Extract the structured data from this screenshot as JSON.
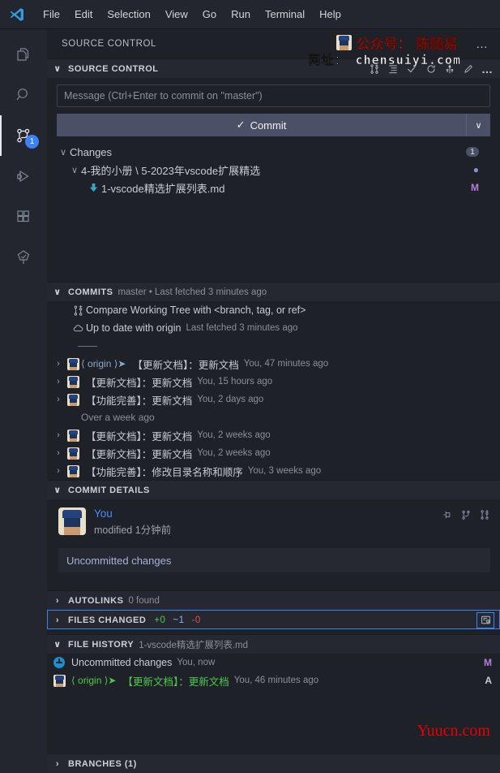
{
  "window": {
    "menu": [
      "File",
      "Edit",
      "Selection",
      "View",
      "Go",
      "Run",
      "Terminal",
      "Help"
    ],
    "logo_name": "vscode-logo"
  },
  "activity_bar": {
    "items": [
      {
        "name": "explorer",
        "icon": "files-icon",
        "badge": null
      },
      {
        "name": "search",
        "icon": "search-icon",
        "badge": null
      },
      {
        "name": "source-control",
        "icon": "source-control-icon",
        "badge": "1"
      },
      {
        "name": "run-and-debug",
        "icon": "run-debug-icon",
        "badge": null
      },
      {
        "name": "extensions",
        "icon": "extensions-icon",
        "badge": null
      },
      {
        "name": "gitlens",
        "icon": "gitlens-tree-icon",
        "badge": null
      }
    ]
  },
  "view_title": {
    "label": "SOURCE CONTROL",
    "more_label": "…"
  },
  "source_control": {
    "header": {
      "label": "SOURCE CONTROL",
      "chevron": "∨",
      "more_label": "…",
      "tools": [
        "git-compare-icon",
        "view-as-tree-icon",
        "commit-check-icon",
        "refresh-icon",
        "source-control-graph-icon",
        "edit-pencil-icon"
      ]
    },
    "message_input": {
      "value": "",
      "placeholder": "Message (Ctrl+Enter to commit on \"master\")"
    },
    "commit_button": {
      "label": "Commit",
      "check_glyph": "✓",
      "dropdown_glyph": "∨"
    },
    "changes_group": {
      "chevron": "∨",
      "label": "Changes",
      "count": "1"
    },
    "folder_row": {
      "chevron": "∨",
      "label": "4-我的小册 \\ 5-2023年vscode扩展精选",
      "status": "●"
    },
    "file_row": {
      "icon": "download-arrow-icon",
      "label": "1-vscode精选扩展列表.md",
      "status": "M"
    }
  },
  "commits": {
    "header": {
      "chevron": "∨",
      "label": "COMMITS",
      "sub": "master • Last fetched 3 minutes ago"
    },
    "actions": [
      {
        "icon": "git-compare-icon",
        "label": "Compare Working Tree with <branch, tag, or ref>"
      },
      {
        "icon": "cloud-icon",
        "label": "Up to date with origin",
        "meta": "Last fetched 3 minutes ago"
      }
    ],
    "items": [
      {
        "chevron": "›",
        "avatar": "user-avatar",
        "origin": "⟨ origin ⟩➤",
        "origin_color": "blue",
        "message": "【更新文档】：更新文档",
        "meta": "You, 47 minutes ago"
      },
      {
        "chevron": "›",
        "avatar": "user-avatar",
        "origin": "",
        "message": "【更新文档】：更新文档",
        "meta": "You, 15 hours ago"
      },
      {
        "chevron": "›",
        "avatar": "user-avatar",
        "origin": "",
        "message": "【功能完善】：更新文档",
        "meta": "You, 2 days ago"
      }
    ],
    "group_label": "Over a week ago",
    "items_old": [
      {
        "chevron": "›",
        "avatar": "user-avatar",
        "message": "【更新文档】：更新文档",
        "meta": "You, 2 weeks ago"
      },
      {
        "chevron": "›",
        "avatar": "user-avatar",
        "message": "【更新文档】：更新文档",
        "meta": "You, 2 weeks ago"
      },
      {
        "chevron": "›",
        "avatar": "user-avatar",
        "message": "【功能完善】：修改目录名称和顺序",
        "meta": "You, 3 weeks ago"
      }
    ]
  },
  "commit_details": {
    "header": {
      "chevron": "∨",
      "label": "COMMIT DETAILS"
    },
    "author": "You",
    "subtitle": "modified 1分钟前",
    "actions": [
      "pin-icon",
      "git-branch-icon",
      "git-compare-icon"
    ],
    "message": "Uncommitted changes"
  },
  "autolinks": {
    "chevron": "›",
    "label": "AUTOLINKS",
    "sub": "0 found"
  },
  "files_changed": {
    "chevron": "›",
    "label": "FILES CHANGED",
    "added": "+0",
    "modified": "~1",
    "deleted": "-0",
    "action_icon": "files-changed-view-icon"
  },
  "file_history": {
    "header": {
      "chevron": "∨",
      "label": "FILE HISTORY",
      "sub": "1-vscode精选扩展列表.md"
    },
    "rows": [
      {
        "icon": "uncommitted-changes-icon",
        "origin": "",
        "label": "Uncommitted changes",
        "meta": "You, now",
        "status": "M"
      },
      {
        "icon": "user-avatar",
        "origin": "⟨ origin ⟩➤",
        "label": "【更新文档】：更新文档",
        "meta": "You, 46 minutes ago",
        "status": "A"
      }
    ]
  },
  "branches": {
    "chevron": "›",
    "label": "BRANCHES (1)"
  },
  "watermarks": {
    "top_line1": "公众号： 陈随易",
    "top_line2": "网址： chensuiyi.com",
    "bottom": "Yuucn.com"
  },
  "colors": {
    "accent_blue": "#3b82f6",
    "commit_button": "#4b5066",
    "panel_bg": "#1f2128",
    "header_bg": "#252830",
    "added_green": "#4ec94e",
    "modified_purple": "#b180d7",
    "watermark_red": "#e8332a"
  }
}
